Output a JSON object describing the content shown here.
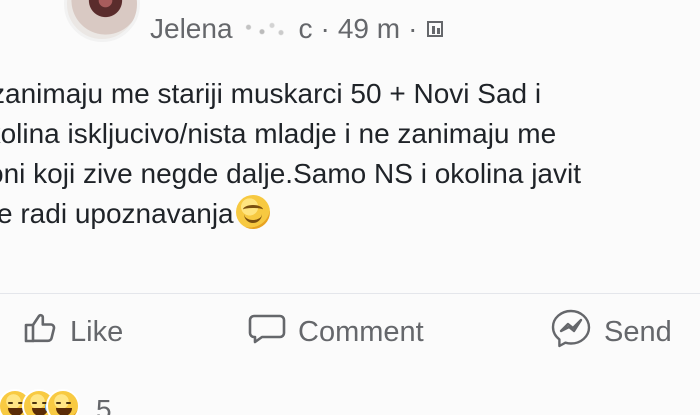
{
  "post": {
    "author_name": "Jelena",
    "author_suffix": "c",
    "time_ago": "49 m",
    "separator": "·",
    "privacy_icon": "group-icon",
    "content_lines": [
      "zanimaju me stariji muskarci 50 + Novi Sad i",
      "okolina iskljucivo/nista mladje i ne zanimaju me",
      "oni koji zive negde dalje.Samo NS i okolina javit",
      "se radi upoznavanja"
    ],
    "trailing_emoji": "smiling-face-icon"
  },
  "actions": {
    "like_label": "Like",
    "comment_label": "Comment",
    "send_label": "Send",
    "like_icon": "like-icon",
    "comment_icon": "comment-icon",
    "send_icon": "messenger-send-icon"
  },
  "reactions": {
    "count": "5",
    "icons": [
      "laughing-face-icon",
      "crying-face-icon",
      "laughing-face-icon"
    ]
  },
  "colors": {
    "text": "#1c1e21",
    "muted": "#65676b",
    "divider": "#e4e6eb",
    "background": "#fbfbfb"
  }
}
